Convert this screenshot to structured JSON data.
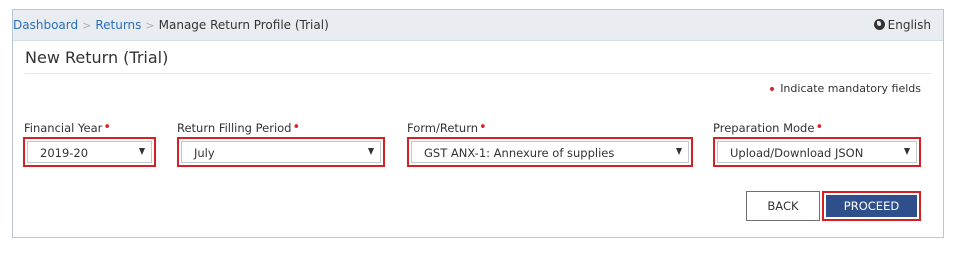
{
  "breadcrumb": {
    "items": [
      "Dashboard",
      "Returns"
    ],
    "current": "Manage Return Profile (Trial)",
    "separator": ">"
  },
  "language": {
    "label": "English",
    "icon": "globe-icon"
  },
  "panel": {
    "title": "New Return (Trial)",
    "mandatory_note": "Indicate mandatory fields",
    "required_marker": "•"
  },
  "fields": {
    "financial_year": {
      "label": "Financial Year",
      "value": "2019-20"
    },
    "return_period": {
      "label": "Return Filling Period",
      "value": "July"
    },
    "form_return": {
      "label": "Form/Return",
      "value": "GST ANX-1: Annexure of supplies"
    },
    "preparation_mode": {
      "label": "Preparation Mode",
      "value": "Upload/Download JSON"
    }
  },
  "buttons": {
    "back": "BACK",
    "proceed": "PROCEED"
  },
  "colors": {
    "accent_red": "#d71f26",
    "primary_blue": "#2e4f8c",
    "link_blue": "#2a6eb5"
  }
}
